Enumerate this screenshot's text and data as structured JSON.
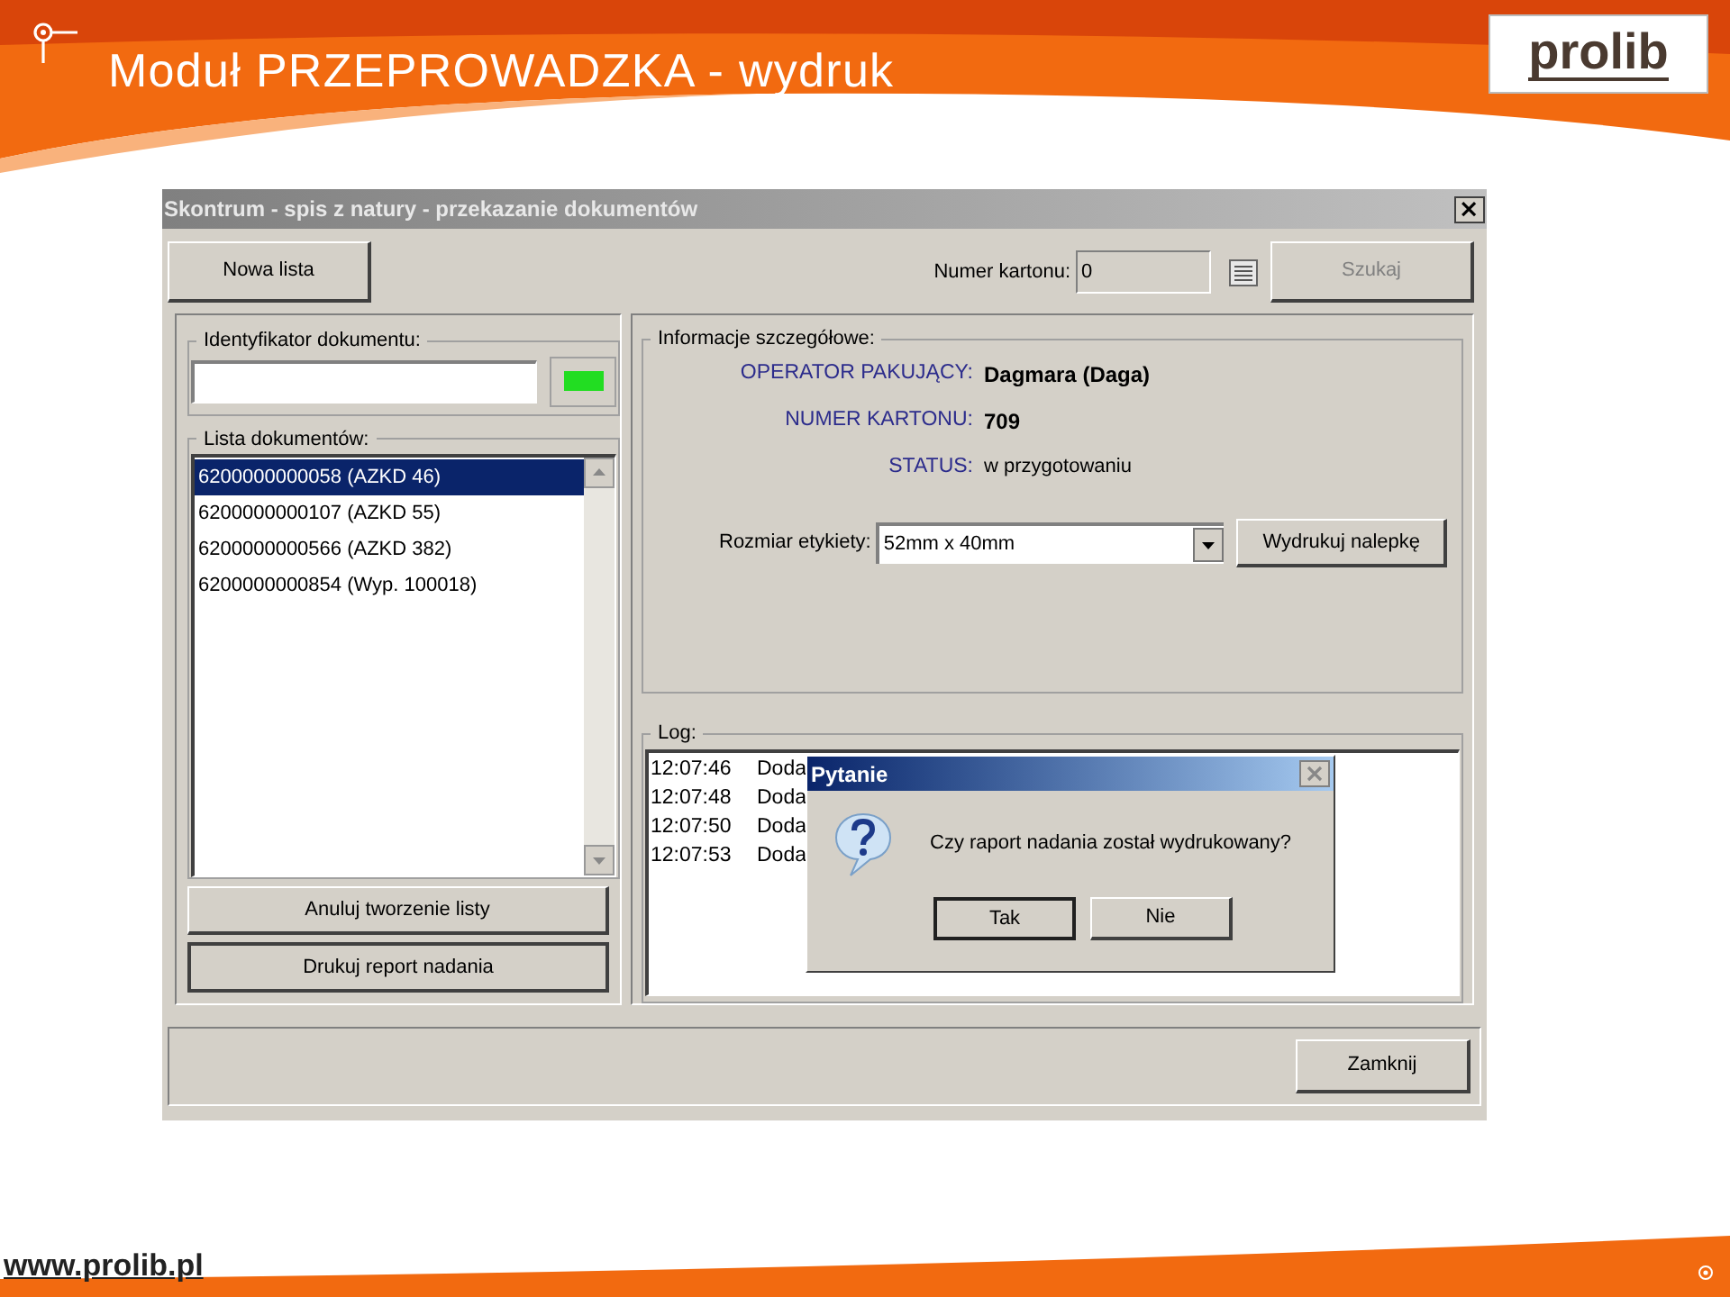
{
  "slide": {
    "title": "Moduł PRZEPROWADZKA - wydruk",
    "logo": "prolib",
    "footer_link": "www.prolib.pl"
  },
  "window": {
    "title": "Skontrum - spis z natury - przekazanie dokumentów"
  },
  "toolbar": {
    "new_list_button": "Nowa lista",
    "carton_label": "Numer kartonu:",
    "carton_value": "0",
    "search_button": {
      "label": "Szukaj",
      "disabled": true
    }
  },
  "document_id": {
    "label": "Identyfikator dokumentu:",
    "indicator": {
      "on": true
    }
  },
  "document_list": {
    "label": "Lista dokumentów:",
    "items": [
      {
        "text": "6200000000058 (AZKD 46)",
        "selected": true
      },
      {
        "text": "6200000000107 (AZKD 55)",
        "selected": false
      },
      {
        "text": "6200000000566 (AZKD 382)",
        "selected": false
      },
      {
        "text": "6200000000854 (Wyp. 100018)",
        "selected": false
      }
    ]
  },
  "cancel_button": "Anuluj tworzenie listy",
  "print_report_button": {
    "label": "Drukuj report nadania",
    "focused": true
  },
  "details": {
    "label": "Informacje szczegółowe:",
    "fields": [
      {
        "label": "OPERATOR PAKUJĄCY:",
        "value": "Dagmara (Daga)",
        "emphasis": true
      },
      {
        "label": "NUMER KARTONU:",
        "value": "709",
        "emphasis": true
      },
      {
        "label": "STATUS:",
        "value": "w przygotowaniu",
        "emphasis": false
      }
    ],
    "label_size_label": "Rozmiar etykiety:",
    "label_size_value": "52mm x 40mm",
    "print_label_button": "Wydrukuj nalepkę"
  },
  "log": {
    "label": "Log:",
    "entries": [
      {
        "time": "12:07:46",
        "text": "Doda"
      },
      {
        "time": "12:07:48",
        "text": "Doda"
      },
      {
        "time": "12:07:50",
        "text": "Doda"
      },
      {
        "time": "12:07:53",
        "text": "Doda"
      }
    ]
  },
  "dialog": {
    "title": "Pytanie",
    "message": "Czy raport nadania został wydrukowany?",
    "buttons": [
      {
        "label": "Tak",
        "default": true
      },
      {
        "label": "Nie",
        "default": false
      }
    ]
  },
  "close_button": "Zamknij"
}
